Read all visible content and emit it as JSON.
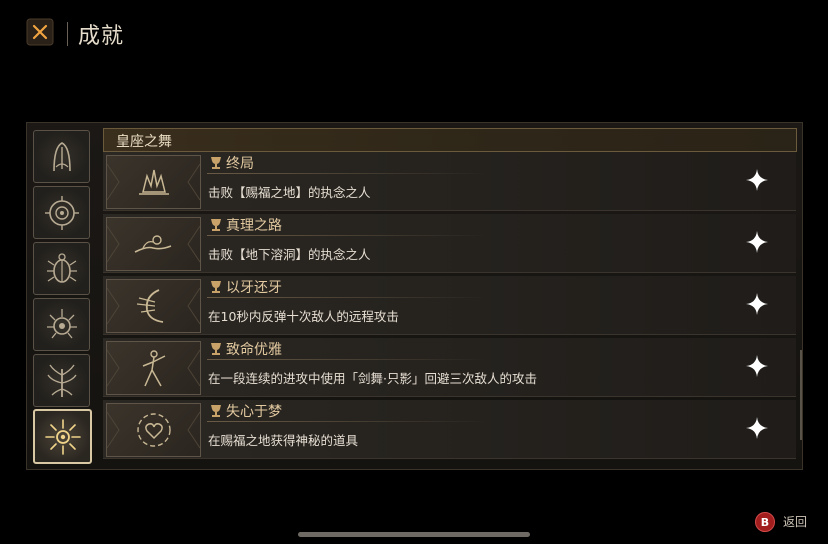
{
  "header": {
    "close_icon": "close-x-icon",
    "title": "成就"
  },
  "categories": [
    {
      "icon": "tree-arch-icon",
      "active": false
    },
    {
      "icon": "ring-eye-icon",
      "active": false
    },
    {
      "icon": "beetle-icon",
      "active": false
    },
    {
      "icon": "thorn-heart-icon",
      "active": false
    },
    {
      "icon": "flame-tree-icon",
      "active": false
    },
    {
      "icon": "radiant-sun-icon",
      "active": true
    }
  ],
  "section": {
    "title": "皇座之舞"
  },
  "achievements": [
    {
      "name": "终局",
      "description": "击败【赐福之地】的执念之人",
      "icon": "throne-crown-icon"
    },
    {
      "name": "真理之路",
      "description": "击败【地下溶洞】的执念之人",
      "icon": "crawling-figure-icon"
    },
    {
      "name": "以牙还牙",
      "description": "在10秒内反弹十次敌人的远程攻击",
      "icon": "crescent-strike-icon"
    },
    {
      "name": "致命优雅",
      "description": "在一段连续的进攻中使用「剑舞·只影」回避三次敌人的攻击",
      "icon": "dancer-icon"
    },
    {
      "name": "失心于梦",
      "description": "在赐福之地获得神秘的道具",
      "icon": "swirl-heart-icon"
    }
  ],
  "footer": {
    "back_button_label": "B",
    "back_text": "返回"
  },
  "colors": {
    "accent_gold": "#e2c9a0",
    "close_orange": "#e59a3c",
    "back_red": "#a21d1d"
  }
}
